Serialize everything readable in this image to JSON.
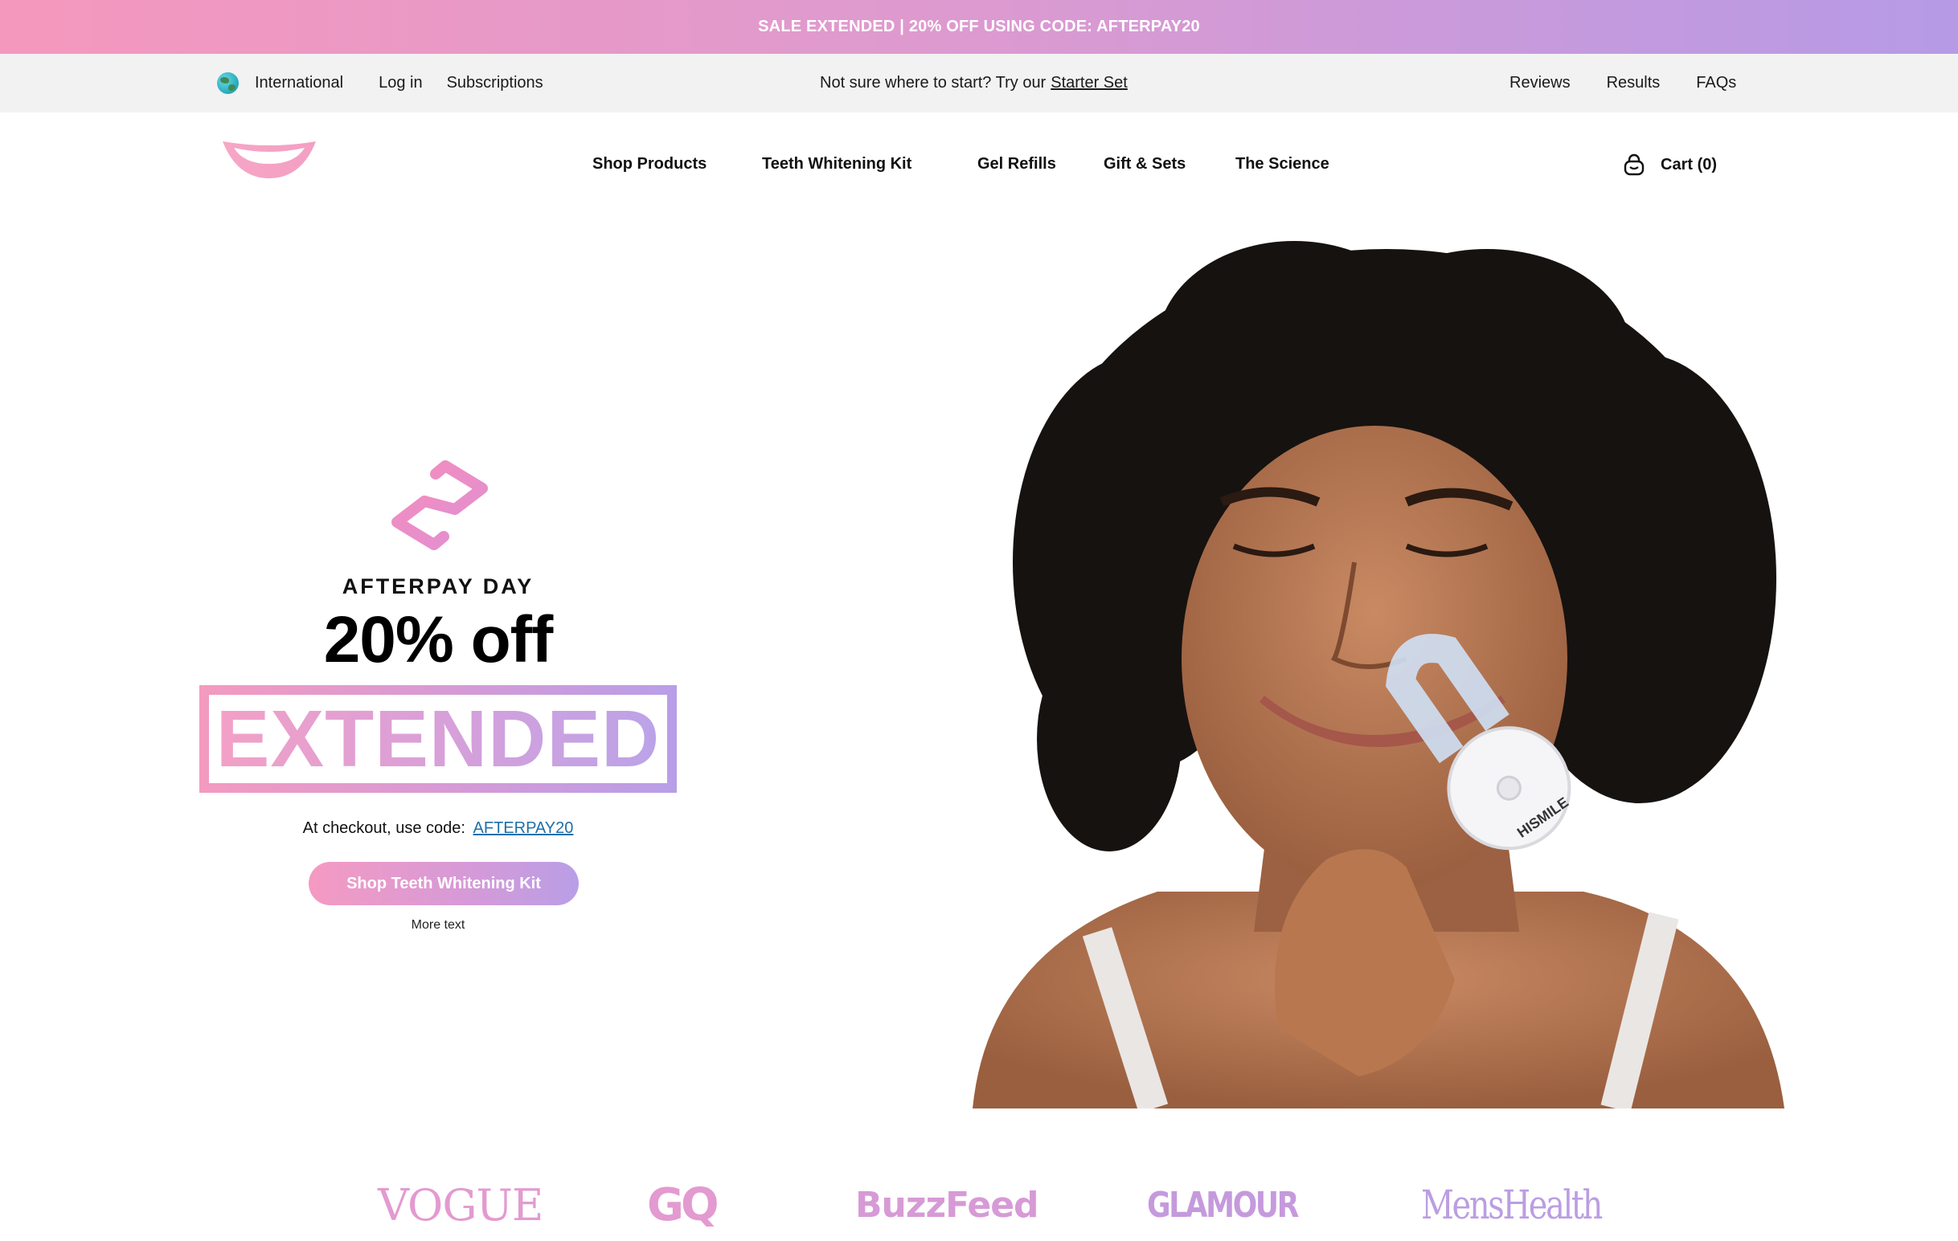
{
  "announcement": {
    "text": "SALE EXTENDED | 20% OFF USING CODE: AFTERPAY20"
  },
  "utility": {
    "international": "International",
    "login": "Log in",
    "subscriptions": "Subscriptions",
    "starter_prefix": "Not sure where to start? Try our",
    "starter_link": "Starter Set",
    "reviews": "Reviews",
    "results": "Results",
    "faqs": "FAQs"
  },
  "nav": {
    "items": [
      {
        "label": "Shop Products"
      },
      {
        "label": "Teeth Whitening Kit"
      },
      {
        "label": "Gel Refills"
      },
      {
        "label": "Gift & Sets"
      },
      {
        "label": "The Science"
      }
    ],
    "cart": "Cart (0)"
  },
  "hero": {
    "eyebrow": "AFTERPAY DAY",
    "headline": "20% off",
    "extended": "EXTENDED",
    "checkout_prefix": "At checkout, use code:",
    "code": "AFTERPAY20",
    "cta": "Shop Teeth Whitening Kit",
    "more_text": "More text",
    "device_brand": "HISMILE"
  },
  "press": [
    "VOGUE",
    "GQ",
    "BuzzFeed",
    "GLAMOUR",
    "MensHealth"
  ],
  "colors": {
    "brand_pink": "#f598bd",
    "brand_purple": "#b69ae6",
    "utility_bg": "#f2f2f2",
    "link_blue": "#1f6fa8"
  },
  "icons": [
    "globe-icon",
    "lips-logo-icon",
    "afterpay-icon",
    "bag-icon"
  ]
}
